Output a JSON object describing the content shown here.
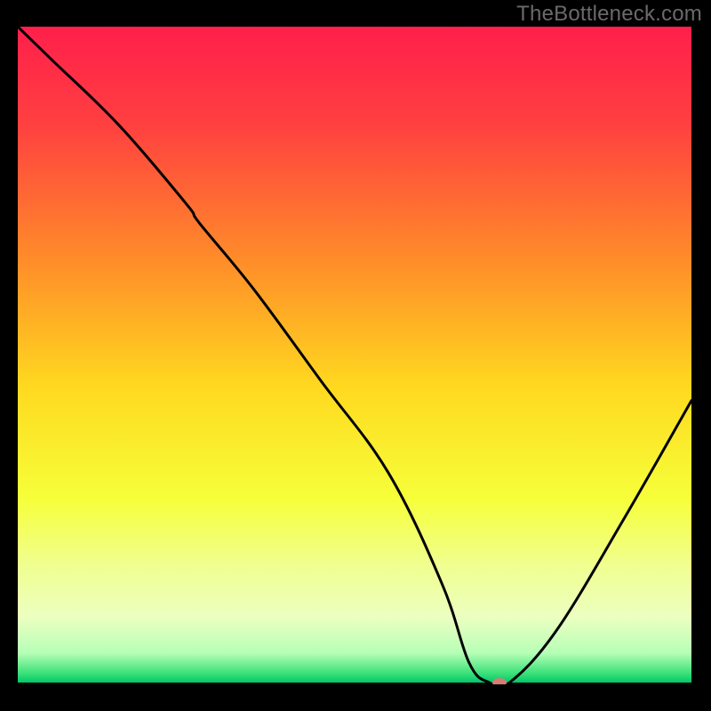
{
  "watermark": "TheBottleneck.com",
  "chart_data": {
    "type": "line",
    "title": "",
    "xlabel": "",
    "ylabel": "",
    "xlim": [
      0,
      100
    ],
    "ylim": [
      0,
      100
    ],
    "grid": false,
    "background_gradient_stops": [
      {
        "offset": 0.0,
        "color": "#ff1f4b"
      },
      {
        "offset": 0.15,
        "color": "#ff4040"
      },
      {
        "offset": 0.35,
        "color": "#ff8a2a"
      },
      {
        "offset": 0.55,
        "color": "#ffd91f"
      },
      {
        "offset": 0.72,
        "color": "#f6ff3a"
      },
      {
        "offset": 0.82,
        "color": "#f0ff8f"
      },
      {
        "offset": 0.9,
        "color": "#ecffc0"
      },
      {
        "offset": 0.955,
        "color": "#b6ffb6"
      },
      {
        "offset": 0.985,
        "color": "#3fe27a"
      },
      {
        "offset": 1.0,
        "color": "#00c76a"
      }
    ],
    "curve": {
      "name": "bottleneck-curve",
      "x": [
        0,
        5,
        15,
        25,
        27,
        35,
        45,
        55,
        63,
        67,
        70,
        73,
        80,
        90,
        100
      ],
      "y": [
        100,
        95,
        85,
        73,
        70,
        60,
        46,
        32,
        15,
        3,
        0,
        0,
        8,
        25,
        43
      ]
    },
    "marker": {
      "name": "highlight-marker",
      "x": 71.5,
      "y": 0,
      "color": "#d87c74",
      "rx": 8,
      "ry": 5
    }
  }
}
